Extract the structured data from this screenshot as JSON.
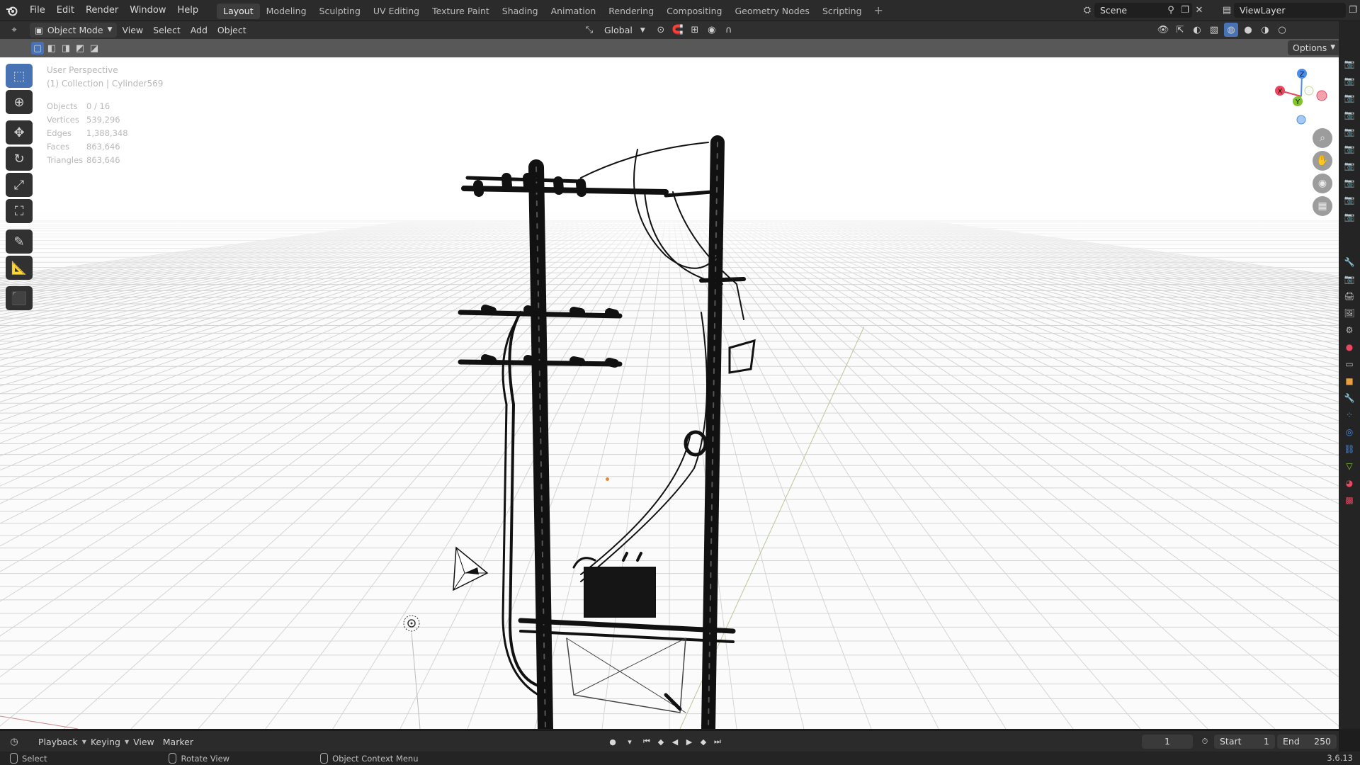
{
  "menubar": {
    "items": [
      "File",
      "Edit",
      "Render",
      "Window",
      "Help"
    ],
    "workspaces": [
      "Layout",
      "Modeling",
      "Sculpting",
      "UV Editing",
      "Texture Paint",
      "Shading",
      "Animation",
      "Rendering",
      "Compositing",
      "Geometry Nodes",
      "Scripting"
    ],
    "active_workspace": "Layout",
    "scene": "Scene",
    "view_layer": "ViewLayer"
  },
  "viewport_header": {
    "mode": "Object Mode",
    "menus": [
      "View",
      "Select",
      "Add",
      "Object"
    ],
    "orientation": "Global",
    "options": "Options"
  },
  "viewport": {
    "perspective": "User Perspective",
    "collection": "(1) Collection | Cylinder569",
    "stats": [
      {
        "label": "Objects",
        "value": "0 / 16"
      },
      {
        "label": "Vertices",
        "value": "539,296"
      },
      {
        "label": "Edges",
        "value": "1,388,348"
      },
      {
        "label": "Faces",
        "value": "863,646"
      },
      {
        "label": "Triangles",
        "value": "863,646"
      }
    ],
    "gizmo": {
      "x": "X",
      "y": "Y",
      "z": "Z"
    }
  },
  "timeline": {
    "menus": [
      "Playback",
      "Keying",
      "View",
      "Marker"
    ],
    "current_frame": "1",
    "start_label": "Start",
    "start": "1",
    "end_label": "End",
    "end": "250"
  },
  "statusbar": {
    "select": "Select",
    "rotate": "Rotate View",
    "context": "Object Context Menu",
    "version": "3.6.13"
  },
  "colors": {
    "accent": "#4772b3",
    "x_axis": "#e8475f",
    "y_axis": "#7fc52a",
    "z_axis": "#4a8ee8"
  }
}
